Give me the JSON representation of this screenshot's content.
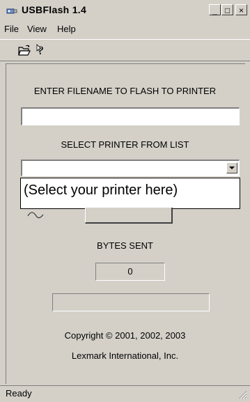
{
  "window": {
    "title": "USBFlash 1.4",
    "minimize_glyph": "_",
    "maximize_glyph": "□",
    "close_glyph": "×"
  },
  "menu": [
    "File",
    "View",
    "Help"
  ],
  "toolbar": {
    "icons": [
      "open-folder-icon",
      "context-help-icon"
    ]
  },
  "form": {
    "filename_label": "ENTER FILENAME TO FLASH TO PRINTER",
    "filename_value": "",
    "printer_label": "SELECT PRINTER FROM LIST",
    "printer_value": "",
    "callout_text": "(Select your printer here)",
    "bytes_label": "BYTES SENT",
    "bytes_value": "0",
    "progress": 0
  },
  "footer": {
    "copyright": "Copyright © 2001, 2002, 2003",
    "company": "Lexmark International, Inc."
  },
  "status": "Ready"
}
